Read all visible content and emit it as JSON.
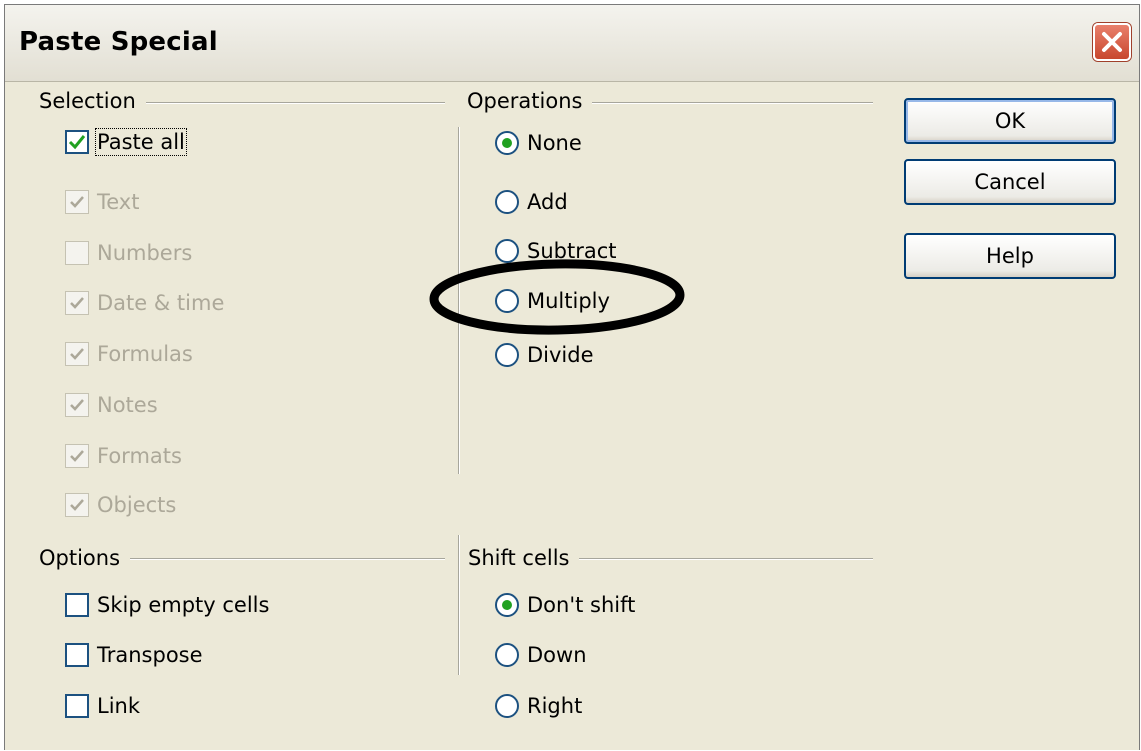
{
  "window": {
    "title": "Paste Special"
  },
  "selection": {
    "title": "Selection",
    "items": [
      {
        "label": "Paste all",
        "checked": true,
        "disabled": false
      },
      {
        "label": "Text",
        "checked": true,
        "disabled": true
      },
      {
        "label": "Numbers",
        "checked": false,
        "disabled": true
      },
      {
        "label": "Date & time",
        "checked": true,
        "disabled": true
      },
      {
        "label": "Formulas",
        "checked": true,
        "disabled": true
      },
      {
        "label": "Notes",
        "checked": true,
        "disabled": true
      },
      {
        "label": "Formats",
        "checked": true,
        "disabled": true
      },
      {
        "label": "Objects",
        "checked": true,
        "disabled": true
      }
    ]
  },
  "operations": {
    "title": "Operations",
    "items": [
      {
        "label": "None",
        "selected": true
      },
      {
        "label": "Add",
        "selected": false
      },
      {
        "label": "Subtract",
        "selected": false
      },
      {
        "label": "Multiply",
        "selected": false
      },
      {
        "label": "Divide",
        "selected": false
      }
    ]
  },
  "options": {
    "title": "Options",
    "items": [
      {
        "label": "Skip empty cells",
        "checked": false
      },
      {
        "label": "Transpose",
        "checked": false
      },
      {
        "label": "Link",
        "checked": false
      }
    ]
  },
  "shift_cells": {
    "title": "Shift cells",
    "items": [
      {
        "label": "Don't shift",
        "selected": true
      },
      {
        "label": "Down",
        "selected": false
      },
      {
        "label": "Right",
        "selected": false
      }
    ]
  },
  "buttons": {
    "ok": "OK",
    "cancel": "Cancel",
    "help": "Help"
  },
  "colors": {
    "radio_dot": "#21a121",
    "check_mark": "#21a121",
    "disabled_text": "#aca899",
    "annotation": "#000000"
  }
}
